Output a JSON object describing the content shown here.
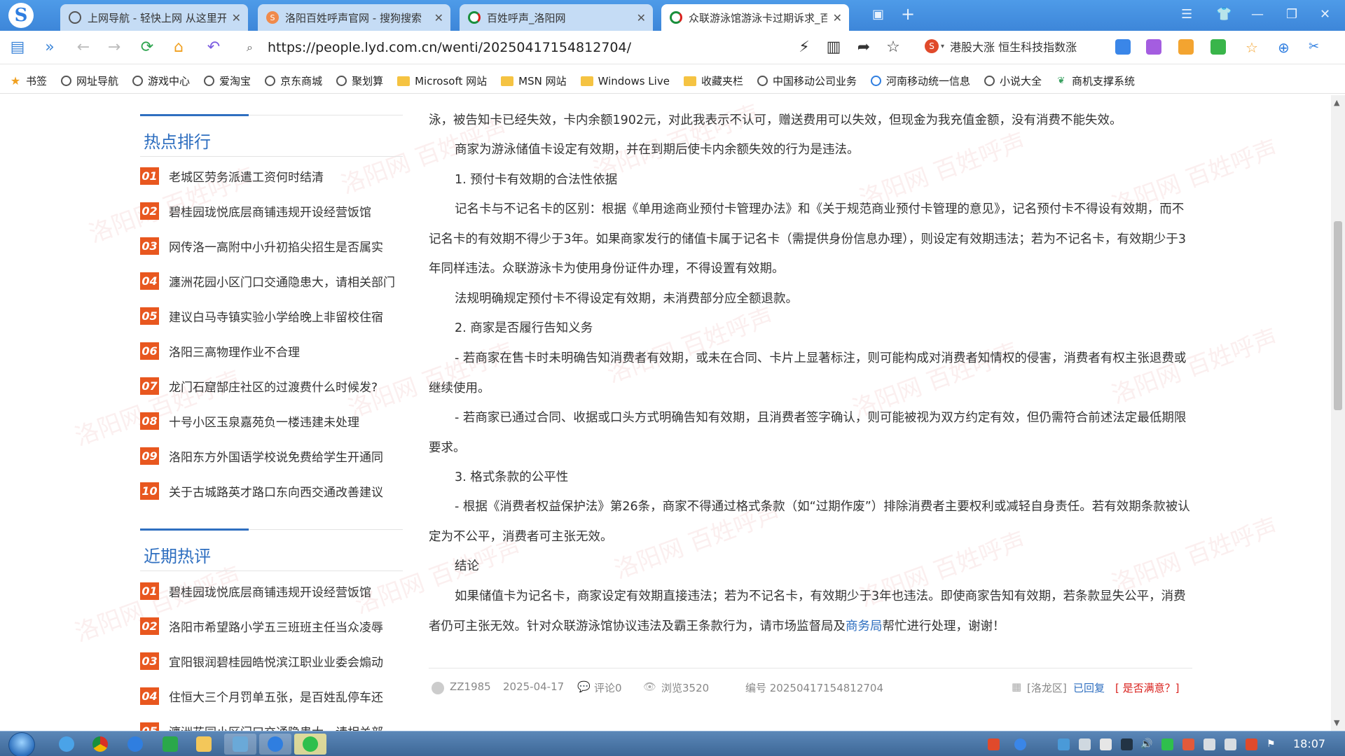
{
  "browser": {
    "logo_letter": "S",
    "tabs": [
      {
        "label": "上网导航 - 轻快上网 从这里开始",
        "icon": "globe-icon",
        "active": false
      },
      {
        "label": "洛阳百姓呼声官网 - 搜狗搜索",
        "icon": "sogou-icon",
        "active": false
      },
      {
        "label": "百姓呼声_洛阳网",
        "icon": "lyd-icon",
        "active": false
      },
      {
        "label": "众联游泳馆游泳卡过期诉求_百姓呼声",
        "icon": "lyd-icon",
        "active": true
      }
    ],
    "close_glyph": "✕",
    "new_tab_glyph": "+",
    "url": "https://people.lyd.com.cn/wenti/20250417154812704/",
    "search_text": "港股大涨 恒生科技指数涨",
    "bookmarks": [
      {
        "label": "书签",
        "icon": "star-icon"
      },
      {
        "label": "网址导航",
        "icon": "globe-icon"
      },
      {
        "label": "游戏中心",
        "icon": "globe-icon"
      },
      {
        "label": "爱淘宝",
        "icon": "globe-icon"
      },
      {
        "label": "京东商城",
        "icon": "globe-icon"
      },
      {
        "label": "聚划算",
        "icon": "globe-icon"
      },
      {
        "label": "Microsoft 网站",
        "icon": "folder-icon"
      },
      {
        "label": "MSN 网站",
        "icon": "folder-icon"
      },
      {
        "label": "Windows Live",
        "icon": "folder-icon"
      },
      {
        "label": "收藏夹栏",
        "icon": "folder-icon"
      },
      {
        "label": "中国移动公司业务",
        "icon": "globe-icon"
      },
      {
        "label": "河南移动统一信息",
        "icon": "globe-icon"
      },
      {
        "label": "小说大全",
        "icon": "globe-icon"
      },
      {
        "label": "商机支撑系统",
        "icon": "leaf-icon"
      }
    ]
  },
  "sidebar": {
    "hot_title": "热点排行",
    "hot_items": [
      {
        "num": "01",
        "text": "老城区劳务派遣工资何时结清"
      },
      {
        "num": "02",
        "text": "碧桂园珑悦底层商铺违规开设经营饭馆"
      },
      {
        "num": "03",
        "text": "网传洛一高附中小升初掐尖招生是否属实"
      },
      {
        "num": "04",
        "text": "瀍洲花园小区门口交通隐患大，请相关部门"
      },
      {
        "num": "05",
        "text": "建议白马寺镇实验小学给晚上非留校住宿"
      },
      {
        "num": "06",
        "text": "洛阳三高物理作业不合理"
      },
      {
        "num": "07",
        "text": "龙门石窟郜庄社区的过渡费什么时候发?"
      },
      {
        "num": "08",
        "text": "十号小区玉泉嘉苑负一楼违建未处理"
      },
      {
        "num": "09",
        "text": "洛阳东方外国语学校说免费给学生开通同"
      },
      {
        "num": "10",
        "text": "关于古城路英才路口东向西交通改善建议"
      }
    ],
    "recent_title": "近期热评",
    "recent_items": [
      {
        "num": "01",
        "text": "碧桂园珑悦底层商铺违规开设经营饭馆"
      },
      {
        "num": "02",
        "text": "洛阳市希望路小学五三班班主任当众凌辱"
      },
      {
        "num": "03",
        "text": "宜阳银润碧桂园皓悦滨江职业业委会煽动"
      },
      {
        "num": "04",
        "text": "住恒大三个月罚单五张，是百姓乱停车还"
      },
      {
        "num": "05",
        "text": "瀍洲花园小区门口交通隐患大，请相关部"
      }
    ]
  },
  "article": {
    "p0": "泳，被告知卡已经失效，卡内余额1902元，对此我表示不认可，赠送费用可以失效，但现金为我充值金额，没有消费不能失效。",
    "p1": "商家为游泳储值卡设定有效期，并在到期后使卡内余额失效的行为是违法。",
    "p2": "1. 预付卡有效期的合法性依据",
    "p3": "记名卡与不记名卡的区别：根据《单用途商业预付卡管理办法》和《关于规范商业预付卡管理的意见》，记名预付卡不得设有效期，而不记名卡的有效期不得少于3年。如果商家发行的储值卡属于记名卡（需提供身份信息办理），则设定有效期违法；若为不记名卡，有效期少于3年同样违法。众联游泳卡为使用身份证件办理，不得设置有效期。",
    "p4": "法规明确规定预付卡不得设定有效期，未消费部分应全额退款。",
    "p5": "2. 商家是否履行告知义务",
    "p6": "- 若商家在售卡时未明确告知消费者有效期，或未在合同、卡片上显著标注，则可能构成对消费者知情权的侵害，消费者有权主张退费或继续使用。",
    "p7": "- 若商家已通过合同、收据或口头方式明确告知有效期，且消费者签字确认，则可能被视为双方约定有效，但仍需符合前述法定最低期限要求。",
    "p8": "3. 格式条款的公平性",
    "p9": "- 根据《消费者权益保护法》第26条，商家不得通过格式条款（如“过期作废”）排除消费者主要权利或减轻自身责任。若有效期条款被认定为不公平，消费者可主张无效。",
    "p10": "结论",
    "p11_a": "如果储值卡为记名卡，商家设定有效期直接违法；若为不记名卡，有效期少于3年也违法。即使商家告知有效期，若条款显失公平，消费者仍可主张无效。针对众联游泳馆协议违法及霸王条款行为，请市场监督局及",
    "p11_link": "商务局",
    "p11_b": "帮忙进行处理，谢谢！"
  },
  "meta": {
    "user": "ZZ1985",
    "date": "2025-04-17",
    "comments": "评论0",
    "views": "浏览3520",
    "number": "编号 20250417154812704",
    "district": "[洛龙区]",
    "status": "已回复",
    "satisfaction": "[ 是否满意？]"
  },
  "taskbar": {
    "clock": "18:07"
  },
  "colors": {
    "accent_blue": "#2f6fc0",
    "badge_orange": "#e8571f",
    "satisfaction_red": "#d9201c"
  }
}
